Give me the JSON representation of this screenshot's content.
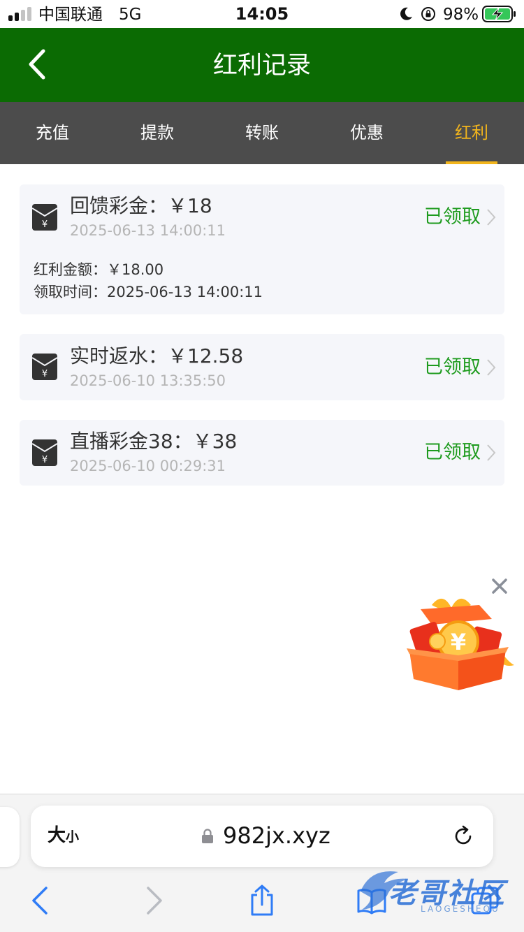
{
  "status_bar": {
    "carrier": "中国联通",
    "network": "5G",
    "time": "14:05",
    "battery": "98%"
  },
  "header": {
    "title": "红利记录"
  },
  "tabs": [
    {
      "label": "充值",
      "active": false
    },
    {
      "label": "提款",
      "active": false
    },
    {
      "label": "转账",
      "active": false
    },
    {
      "label": "优惠",
      "active": false
    },
    {
      "label": "红利",
      "active": true
    }
  ],
  "records": [
    {
      "title": "回馈彩金：￥18",
      "date": "2025-06-13 14:00:11",
      "status": "已领取",
      "details": [
        {
          "label": "红利金额：",
          "value": "￥18.00"
        },
        {
          "label": "领取时间：",
          "value": "2025-06-13 14:00:11"
        }
      ]
    },
    {
      "title": "实时返水：￥12.58",
      "date": "2025-06-10 13:35:50",
      "status": "已领取"
    },
    {
      "title": "直播彩金38：￥38",
      "date": "2025-06-10 00:29:31",
      "status": "已领取"
    }
  ],
  "browser": {
    "text_size_big": "大",
    "text_size_small": "小",
    "url": "982jx.xyz"
  },
  "watermark": {
    "text": "老哥社区",
    "sub": "LAOGESHEQU"
  },
  "colors": {
    "header_green": "#0b6b03",
    "tab_bar": "#4c4c4c",
    "active_tab": "#f2b51c",
    "status_green": "#1e9b1e",
    "card_bg": "#f5f6fa",
    "safari_blue": "#2f7cf6"
  },
  "icons": [
    "back-icon",
    "envelope-yuan-icon",
    "chevron-right-icon",
    "close-icon",
    "gift-box-icon",
    "lock-icon",
    "reload-icon",
    "back-arrow-icon",
    "forward-arrow-icon",
    "share-icon",
    "bookmarks-icon",
    "tabs-icon"
  ]
}
